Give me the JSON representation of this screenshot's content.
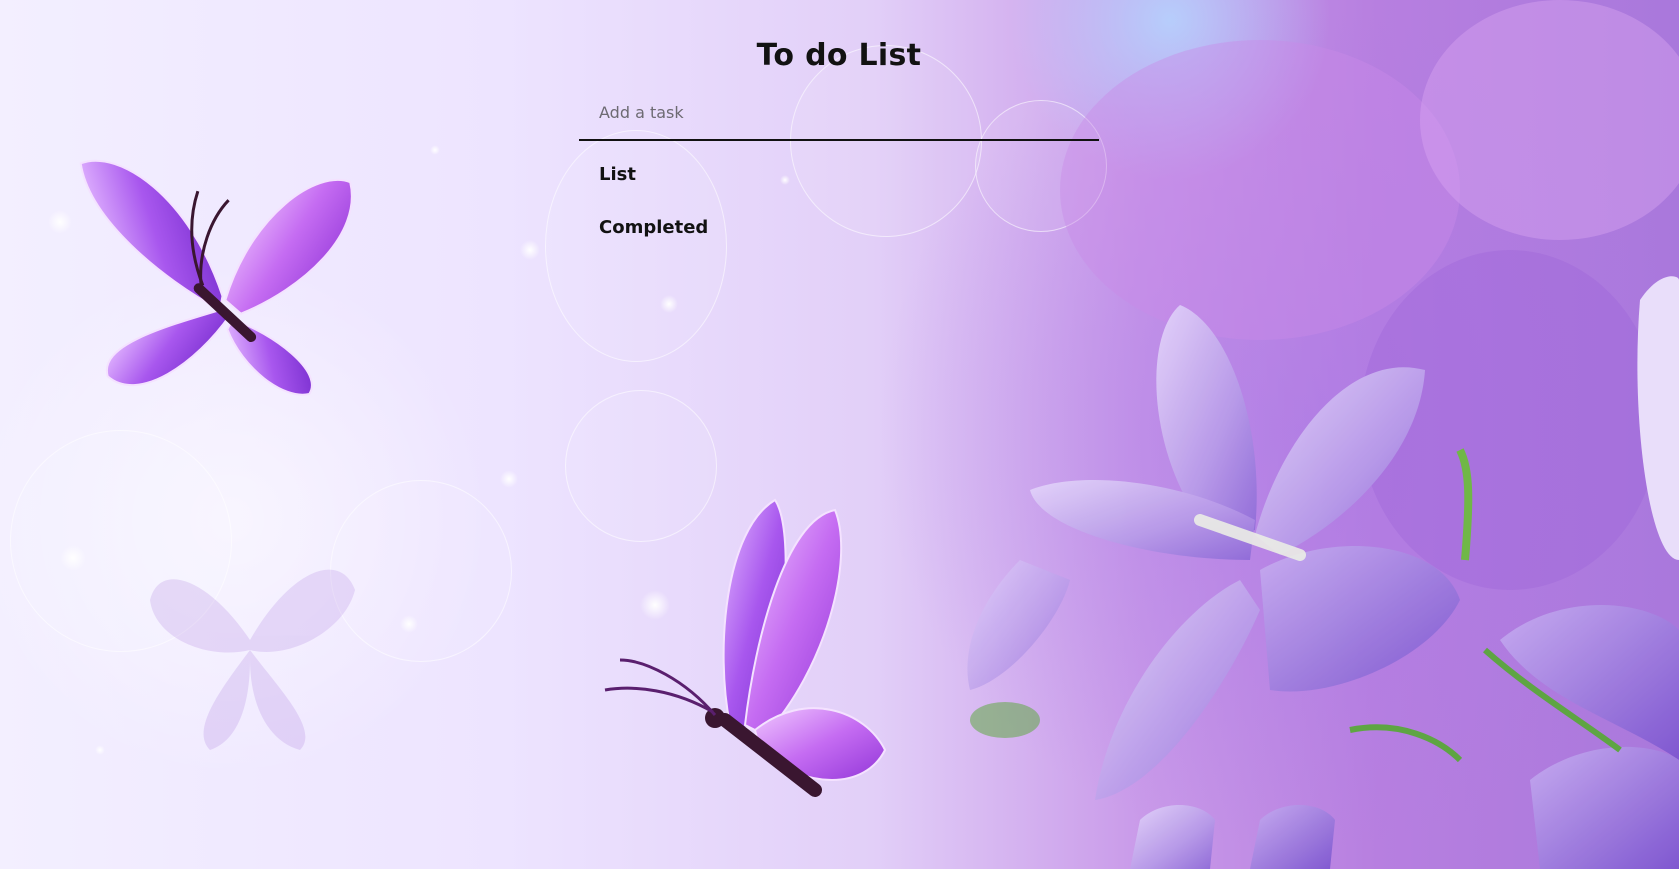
{
  "app": {
    "title": "To do List"
  },
  "input": {
    "placeholder": "Add a task",
    "value": ""
  },
  "sections": {
    "list_label": "List",
    "completed_label": "Completed"
  },
  "background": {
    "description_colors": {
      "lavender": "#ede4ff",
      "violet": "#b77fe0",
      "butterfly": "#9b4be0"
    }
  }
}
